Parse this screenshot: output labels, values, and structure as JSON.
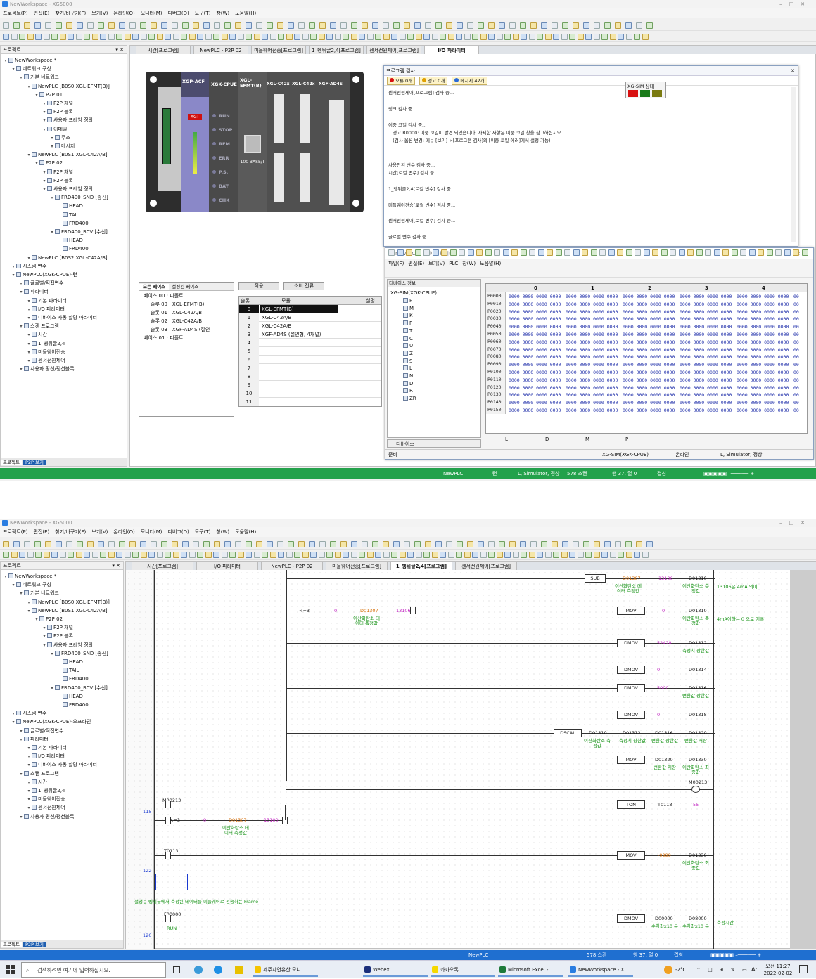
{
  "top": {
    "title": "NewWorkspace - XG5000",
    "menu": [
      "프로젝트(P)",
      "편집(E)",
      "찾기/바꾸기(F)",
      "보기(V)",
      "온라인(O)",
      "모니터(M)",
      "디버그(D)",
      "도구(T)",
      "창(W)",
      "도움말(H)"
    ],
    "project_panel": {
      "title": "프로젝트",
      "tree": [
        {
          "label": "NewWorkspace *",
          "level": 0
        },
        {
          "label": "네트워크 구성",
          "level": 1
        },
        {
          "label": "기본 네트워크",
          "level": 2
        },
        {
          "label": "NewPLC [B0S0 XGL-EFMT(B)]",
          "level": 3
        },
        {
          "label": "P2P 01",
          "level": 4
        },
        {
          "label": "P2P 채널",
          "level": 5
        },
        {
          "label": "P2P 블록",
          "level": 5
        },
        {
          "label": "사용자 프레임 정의",
          "level": 5
        },
        {
          "label": "이메일",
          "level": 5
        },
        {
          "label": "주소",
          "level": 6
        },
        {
          "label": "메시지",
          "level": 6
        },
        {
          "label": "NewPLC [B0S1 XGL-C42A/B]",
          "level": 3
        },
        {
          "label": "P2P 02",
          "level": 4
        },
        {
          "label": "P2P 채널",
          "level": 5
        },
        {
          "label": "P2P 블록",
          "level": 5
        },
        {
          "label": "사용자 프레임 정의",
          "level": 5
        },
        {
          "label": "FRD400_SND [송신]",
          "level": 6
        },
        {
          "label": "HEAD",
          "level": 7
        },
        {
          "label": "TAIL",
          "level": 7
        },
        {
          "label": "FRD400",
          "level": 7
        },
        {
          "label": "FRD400_RCV [수신]",
          "level": 6
        },
        {
          "label": "HEAD",
          "level": 7
        },
        {
          "label": "FRD400",
          "level": 7
        },
        {
          "label": "NewPLC [B0S2 XGL-C42A/B]",
          "level": 3
        },
        {
          "label": "시스템 변수",
          "level": 1
        },
        {
          "label": "NewPLC(XGK-CPUE)-런",
          "level": 1
        },
        {
          "label": "글로벌/직접변수",
          "level": 2
        },
        {
          "label": "파라미터",
          "level": 2
        },
        {
          "label": "기본 파라미터",
          "level": 3
        },
        {
          "label": "I/O 파라미터",
          "level": 3
        },
        {
          "label": "디바이스 자동 할당 파라미터",
          "level": 3
        },
        {
          "label": "스캔 프로그램",
          "level": 2
        },
        {
          "label": "시간",
          "level": 3
        },
        {
          "label": "1_벵뒤굴2,4",
          "level": 3
        },
        {
          "label": "미들웨어전송",
          "level": 3
        },
        {
          "label": "센서전원제어",
          "level": 3
        },
        {
          "label": "사용자 펑션/펑션블록",
          "level": 2
        }
      ],
      "bottom_tabs": [
        "프로젝트",
        "P2P 보기"
      ]
    },
    "doc_tabs": [
      "시간[프로그램]",
      "NewPLC - P2P 02",
      "미들웨어전송[프로그램]",
      "1_벵뒤굴2,4[프로그램]",
      "센서전원제어[프로그램]",
      "I/O 파라미터"
    ],
    "active_tab_index": 5,
    "rack": {
      "modules": [
        "XGP-ACF",
        "XGK-CPUE",
        "XGL-EFMT(B)",
        "XGL-C42x",
        "XGL-C42x",
        "XGF-AD4S"
      ],
      "leds": [
        "RUN",
        "STOP",
        "REM",
        "ERR",
        "P.S.",
        "BAT",
        "CHK"
      ],
      "brand": "XGT",
      "port_label": "100 BASE/T"
    },
    "io_param": {
      "left_tabs": [
        "모든 베이스",
        "설정된 베이스"
      ],
      "base_tree": [
        "베이스 00 : 디폴트",
        "슬롯 00 : XGL-EFMT(B)",
        "슬롯 01 : XGL-C42A/B",
        "슬롯 02 : XGL-C42A/B",
        "슬롯 03 : XGF-AD4S (절연",
        "베이스 01 : 디폴트"
      ],
      "buttons": [
        "적용",
        "소비 전류"
      ],
      "headers": [
        "슬롯",
        "모듈",
        "설명"
      ],
      "slots": [
        {
          "slot": "0",
          "module": "XGL-EFMT(B)"
        },
        {
          "slot": "1",
          "module": "XGL-C42A/B"
        },
        {
          "slot": "2",
          "module": "XGL-C42A/B"
        },
        {
          "slot": "3",
          "module": "XGF-AD4S (절연형, 4채널)"
        },
        {
          "slot": "4",
          "module": ""
        },
        {
          "slot": "5",
          "module": ""
        },
        {
          "slot": "6",
          "module": ""
        },
        {
          "slot": "7",
          "module": ""
        },
        {
          "slot": "8",
          "module": ""
        },
        {
          "slot": "9",
          "module": ""
        },
        {
          "slot": "10",
          "module": ""
        },
        {
          "slot": "11",
          "module": ""
        }
      ]
    },
    "check_window": {
      "title": "프로그램 검사",
      "filters": [
        "오류 0개",
        "경고 0개",
        "메시지 42개"
      ],
      "lines": [
        "센서전원제어[프로그램] 검사 중...",
        "",
        "링크 검사 중...",
        "",
        "이중 코일 검사 중...",
        "   경고 R0000: 이중 코일이 발견 되었습니다. 자세한 사항은 이중 코일 창을 참고하십시오.",
        "   (검사 옵션 변경: 메뉴 [보기]->[프로그램 검사]의 [이중 코일 에러]에서 설정 가능)",
        "",
        "",
        "사용안된 변수 검사 중...",
        "시간[로컬 변수] 검사 중...",
        "",
        "1_벵뒤굴2,4[로컬 변수] 검사 중...",
        "",
        "미들웨어전송[로컬 변수] 검사 중...",
        "",
        "센서전원제어[로컬 변수] 검사 중...",
        "",
        "글로벌 변수 검사 중..."
      ],
      "sim_title": "XG-SIM 상태",
      "sim_colors": [
        "#d81010",
        "#1a7a1a",
        "#7a7a10"
      ]
    },
    "device_monitor": {
      "title": "NewPLC - 디바이스 모니터 - [P]",
      "menu": [
        "파일(F)",
        "편집(E)",
        "보기(V)",
        "PLC",
        "창(W)",
        "도움말(H)"
      ],
      "info_title": "디바이스 정보",
      "root": "XG-SIM(XGK-CPUE)",
      "devices": [
        "P",
        "M",
        "K",
        "F",
        "T",
        "C",
        "U",
        "Z",
        "S",
        "L",
        "N",
        "D",
        "R",
        "ZR"
      ],
      "col_headers": [
        "0",
        "1",
        "2",
        "3",
        "4"
      ],
      "rows": [
        "P0000",
        "P0010",
        "P0020",
        "P0030",
        "P0040",
        "P0050",
        "P0060",
        "P0070",
        "P0080",
        "P0090",
        "P0100",
        "P0110",
        "P0120",
        "P0130",
        "P0140",
        "P0150"
      ],
      "cell_value": "0000 0000 0000 0000",
      "partial_cell": "00",
      "bottom_tabs": [
        "L",
        "D",
        "M",
        "P"
      ],
      "left_tab": "디바이스",
      "status": {
        "ready": "준비",
        "cpu": "XG-SIM(XGK-CPUE)",
        "online": "온라인",
        "state": "L, Simulator, 정상"
      }
    },
    "statusbar": {
      "plc": "NewPLC",
      "run": "런",
      "sim": "L, Simulator, 정상",
      "scan": "578 스캔",
      "pos": "행 37, 열 0",
      "overwrite": "겹침"
    }
  },
  "bottom": {
    "title": "NewWorkspace - XG5000",
    "project_tree": [
      {
        "label": "NewWorkspace *",
        "level": 0
      },
      {
        "label": "네트워크 구성",
        "level": 1
      },
      {
        "label": "기본 네트워크",
        "level": 2
      },
      {
        "label": "NewPLC [B0S0 XGL-EFMT(B)]",
        "level": 3
      },
      {
        "label": "NewPLC [B0S1 XGL-C42A/B]",
        "level": 3
      },
      {
        "label": "P2P 02",
        "level": 4
      },
      {
        "label": "P2P 채널",
        "level": 5
      },
      {
        "label": "P2P 블록",
        "level": 5
      },
      {
        "label": "사용자 프레임 정의",
        "level": 5
      },
      {
        "label": "FRD400_SND [송신]",
        "level": 6
      },
      {
        "label": "HEAD",
        "level": 7
      },
      {
        "label": "TAIL",
        "level": 7
      },
      {
        "label": "FRD400",
        "level": 7
      },
      {
        "label": "FRD400_RCV [수신]",
        "level": 6
      },
      {
        "label": "HEAD",
        "level": 7
      },
      {
        "label": "FRD400",
        "level": 7
      },
      {
        "label": "시스템 변수",
        "level": 1
      },
      {
        "label": "NewPLC(XGK-CPUE)-오프라인",
        "level": 1
      },
      {
        "label": "글로벌/직접변수",
        "level": 2
      },
      {
        "label": "파라미터",
        "level": 2
      },
      {
        "label": "기본 파라미터",
        "level": 3
      },
      {
        "label": "I/O 파라미터",
        "level": 3
      },
      {
        "label": "디바이스 자동 할당 파라미터",
        "level": 3
      },
      {
        "label": "스캔 프로그램",
        "level": 2
      },
      {
        "label": "시간",
        "level": 3
      },
      {
        "label": "1_벵뒤굴2,4",
        "level": 3
      },
      {
        "label": "미들웨어전송",
        "level": 3
      },
      {
        "label": "센서전원제어",
        "level": 3
      },
      {
        "label": "사용자 펑션/펑션블록",
        "level": 2
      }
    ],
    "doc_tabs": [
      "시간[프로그램]",
      "I/O 파라미터",
      "NewPLC - P2P 02",
      "미들웨어전송[프로그램]",
      "1_벵뒤굴2,4[프로그램]",
      "센서전원제어[프로그램]"
    ],
    "active_tab_index": 4,
    "ladder": {
      "rung_numbers": [
        "115",
        "122",
        "126"
      ],
      "sub": {
        "op": "SUB",
        "a": "D01307",
        "b": "13106",
        "d": "D01310",
        "a_cmt": "이산화탄소 데이터 측정값",
        "d_cmt": "이산화탄소 측정값"
      },
      "note1": "13106은 4mA 의미",
      "cmp1": {
        "op": "<=3",
        "a": "0",
        "b": "D01307",
        "c": "13106",
        "b_cmt": "이산화탄소 데이터 측정값"
      },
      "mov1": {
        "op": "MOV",
        "s": "0",
        "d": "D01310",
        "d_cmt": "이산화탄소 측정값"
      },
      "note2": "4mA이하는 0 으로 기록",
      "dmov1": {
        "op": "DMOV",
        "s": "52428",
        "d": "D01312",
        "d_cmt": "측정치 상한값"
      },
      "dmov2": {
        "op": "DMOV",
        "s": "0",
        "d": "D01314"
      },
      "dmov3": {
        "op": "DMOV",
        "s": "5000",
        "d": "D01316",
        "d_cmt": "변환값 상한값"
      },
      "dmov4": {
        "op": "DMOV",
        "s": "0",
        "d": "D01318"
      },
      "dscal": {
        "op": "DSCAL",
        "a": "D01310",
        "b": "D01312",
        "c": "D01316",
        "d": "D01320",
        "a_cmt": "이산화탄소 측정값",
        "b_cmt": "측정치 상한값",
        "c_cmt": "변환값 상한값",
        "d_cmt": "변환값 저장"
      },
      "mov2": {
        "op": "MOV",
        "s": "D01320",
        "d": "D01330",
        "s_cmt": "변환값 저장",
        "d_cmt": "이산화탄소 최종값"
      },
      "coil": "M00213",
      "contact1": "M00213",
      "ton": {
        "op": "TON",
        "t": "T0113",
        "v": "55"
      },
      "cmp2": {
        "op": "<=3",
        "a": "0",
        "b": "D01307",
        "c": "13100",
        "b_cmt": "이산화탄소 데이터 측정값"
      },
      "contact2": "T0113",
      "mov3": {
        "op": "MOV",
        "s": "-9999",
        "d": "D01330",
        "d_cmt": "이산화탄소 최종값"
      },
      "comment": "설명문  벵뒤굴에서 측정된 데이터를 미들웨어로 전송하는 Frame",
      "contact3": "F00000",
      "contact3_cmt": "RUN",
      "dmov5": {
        "op": "DMOV",
        "s": "D00000",
        "d": "D08000",
        "s_cmt": "수치값x10 분",
        "d_cmt": "수치값x10 분"
      },
      "note3": "측정시간"
    },
    "statusbar": {
      "plc": "NewPLC",
      "scan": "578 스캔",
      "pos": "행 37, 열 0",
      "overwrite": "겹침"
    }
  },
  "taskbar": {
    "search": "검색하려면 여기에 입력하십시오.",
    "apps": [
      "제주자연유산 모니...",
      "Webex",
      "카카오톡",
      "Microsoft Excel - ...",
      "NewWorkspace - X..."
    ],
    "weather": "-2°C",
    "time": "오전 11:27",
    "date": "2022-02-02",
    "lang": "A"
  }
}
